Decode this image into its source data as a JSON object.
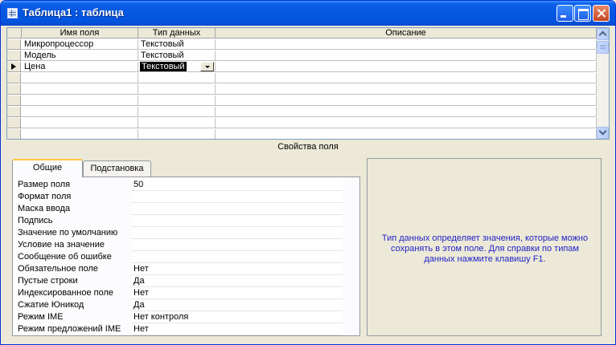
{
  "window": {
    "title": "Таблица1 : таблица"
  },
  "grid": {
    "headers": {
      "field_name": "Имя поля",
      "data_type": "Тип данных",
      "description": "Описание"
    },
    "rows": [
      {
        "name": "Микропроцессор",
        "type": "Текстовый",
        "description": ""
      },
      {
        "name": "Модель",
        "type": "Текстовый",
        "description": ""
      },
      {
        "name": "Цена",
        "type": "Текстовый",
        "description": ""
      }
    ],
    "current_row": 2
  },
  "properties": {
    "section_title": "Свойства поля",
    "tabs": [
      {
        "label": "Общие",
        "active": true
      },
      {
        "label": "Подстановка",
        "active": false
      }
    ],
    "items": [
      {
        "label": "Размер поля",
        "value": "50"
      },
      {
        "label": "Формат поля",
        "value": ""
      },
      {
        "label": "Маска ввода",
        "value": ""
      },
      {
        "label": "Подпись",
        "value": ""
      },
      {
        "label": "Значение по умолчанию",
        "value": ""
      },
      {
        "label": "Условие на значение",
        "value": ""
      },
      {
        "label": "Сообщение об ошибке",
        "value": ""
      },
      {
        "label": "Обязательное поле",
        "value": "Нет"
      },
      {
        "label": "Пустые строки",
        "value": "Да"
      },
      {
        "label": "Индексированное поле",
        "value": "Нет"
      },
      {
        "label": "Сжатие Юникод",
        "value": "Да"
      },
      {
        "label": "Режим IME",
        "value": "Нет контроля"
      },
      {
        "label": "Режим предложений IME",
        "value": "Нет"
      }
    ],
    "help_text": "Тип данных определяет значения, которые можно сохранять в этом поле.  Для справки по типам данных нажмите клавишу F1."
  }
}
